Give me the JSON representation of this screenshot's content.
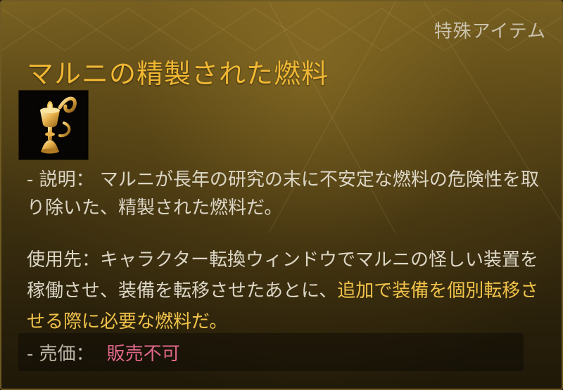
{
  "tooltip": {
    "category": "特殊アイテム",
    "title": "マルニの精製された燃料",
    "icon": "golden-oil-lamp-icon",
    "description": {
      "label": "- 説明：",
      "text": "マルニが長年の研究の末に不安定な燃料の危険性を取り除いた、精製された燃料だ。"
    },
    "usage": {
      "text": "使用先：キャラクター転換ウィンドウでマルニの怪しい装置を稼働させ、装備を転移させたあとに、",
      "highlight": "追加で装備を個別転移させる際に必要な燃料だ。"
    },
    "price": {
      "label": "- 売価：",
      "value": "販売不可"
    }
  },
  "colors": {
    "title": "#f0b733",
    "highlight": "#f0c24a",
    "price_value": "#e0678a",
    "body_text": "#dcd6c6"
  }
}
